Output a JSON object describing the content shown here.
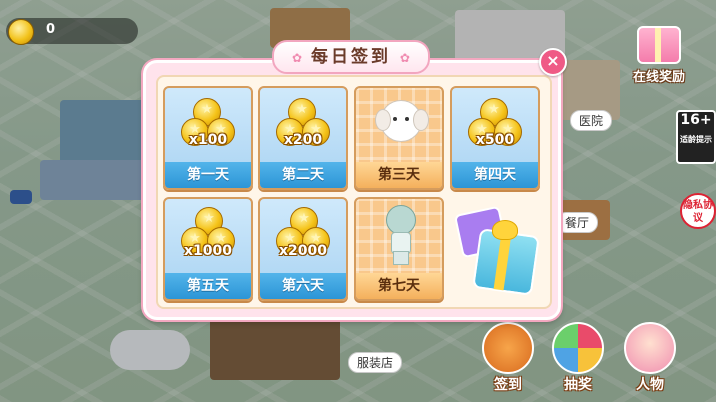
{
  "hud": {
    "coins": "0"
  },
  "dialog": {
    "title": "每日签到",
    "close_label": "×",
    "days": [
      {
        "label": "第一天",
        "reward": "x100",
        "kind": "coins"
      },
      {
        "label": "第二天",
        "reward": "x200",
        "kind": "coins"
      },
      {
        "label": "第三天",
        "reward": "",
        "kind": "pet-dog"
      },
      {
        "label": "第四天",
        "reward": "x500",
        "kind": "coins"
      },
      {
        "label": "第五天",
        "reward": "x1000",
        "kind": "coins"
      },
      {
        "label": "第六天",
        "reward": "x2000",
        "kind": "coins"
      },
      {
        "label": "第七天",
        "reward": "",
        "kind": "doll"
      }
    ],
    "bonus_icon": "gift-box-icon"
  },
  "right_menu": {
    "online_reward": "在线奖励",
    "age_rating": "16+",
    "age_note": "适龄提示",
    "privacy": "隐私协议"
  },
  "map_labels": {
    "hospital": "医院",
    "restaurant": "餐厅",
    "clothing_store": "服装店"
  },
  "bottom_menu": {
    "sign_in": "签到",
    "lottery": "抽奖",
    "character": "人物"
  },
  "colors": {
    "pink_frame": "#f3a8c0",
    "blue_tile": "#a9d3f2",
    "gold_tile": "#f9c88c",
    "close": "#ef5a86"
  }
}
